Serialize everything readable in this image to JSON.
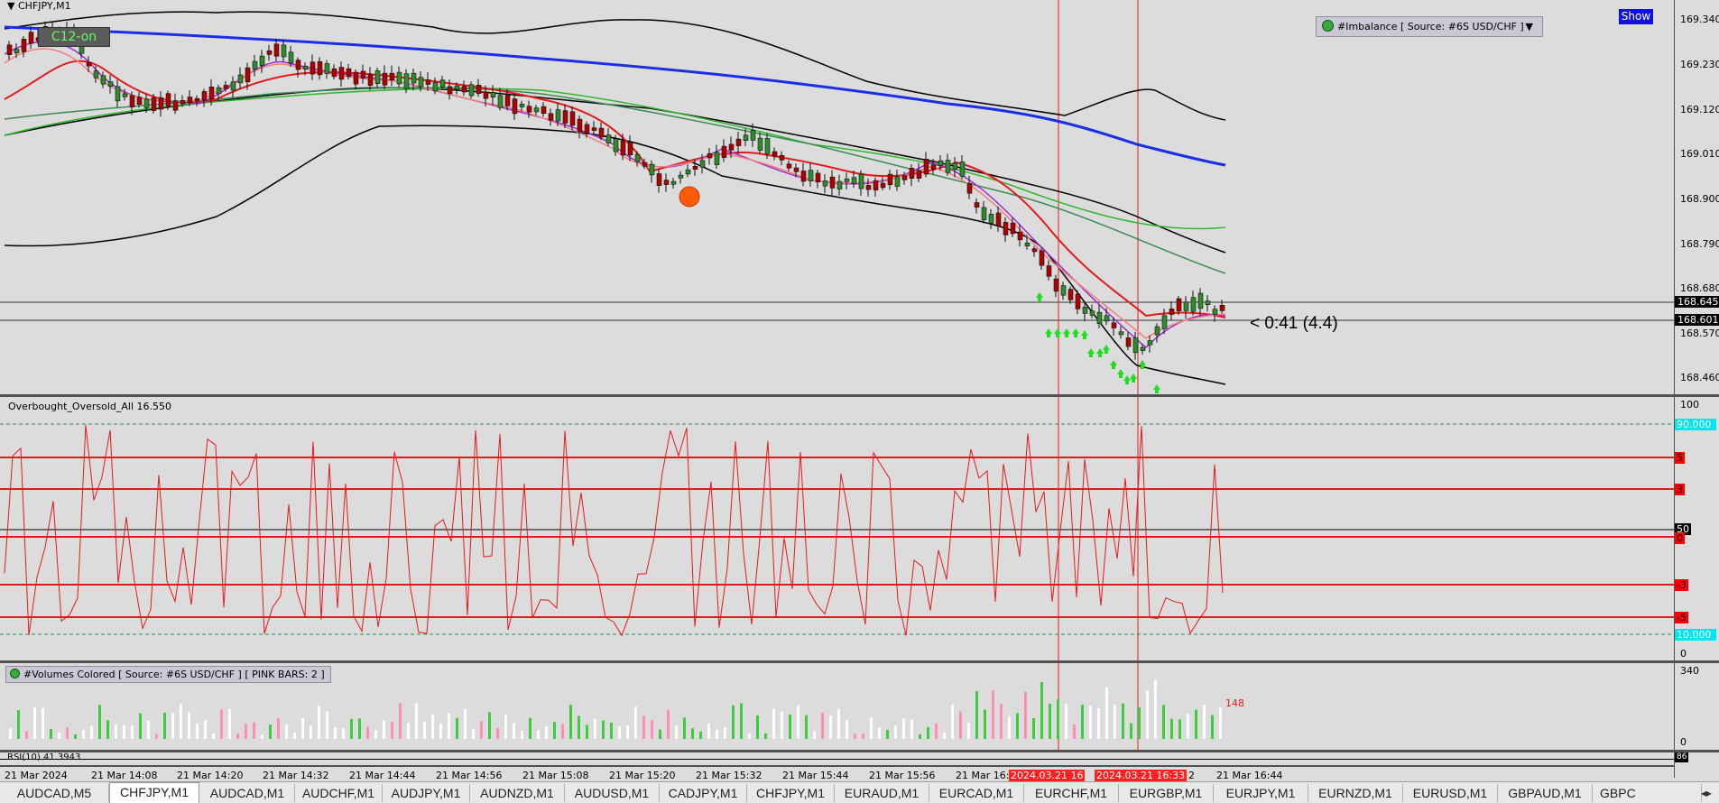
{
  "main": {
    "symbol_label": "CHFJPY,M1",
    "badge": "C12-on",
    "show_button": "Show",
    "imbalance_label": "#Imbalance [ Source: #6S USD/CHF ]",
    "spread_text": "< 0:41 (4.4)",
    "price_axis": [
      "169.340",
      "169.230",
      "169.120",
      "169.010",
      "168.900",
      "168.790",
      "168.680",
      "168.570",
      "168.460"
    ],
    "price_tags": [
      "168.645",
      "168.601"
    ]
  },
  "oscillator": {
    "label": "Overbought_Oversold_All 16.550",
    "axis_top": "100",
    "axis_bottom": "0",
    "level_tags": [
      "90.000",
      "5",
      "3",
      "0",
      "-3",
      "-5",
      "10.000"
    ],
    "mid_tag": "50"
  },
  "volumes": {
    "label": "#Volumes Colored [ Source: #6S USD/CHF ]  [ PINK BARS: 2 ]",
    "axis_top": "340",
    "axis_bottom": "0",
    "last_value": "148"
  },
  "rsi": {
    "label": "RSI(10) 41.3943",
    "tag": "86"
  },
  "time_axis": [
    "21 Mar 2024",
    "21 Mar 14:08",
    "21 Mar 14:20",
    "21 Mar 14:32",
    "21 Mar 14:44",
    "21 Mar 14:56",
    "21 Mar 15:08",
    "21 Mar 15:20",
    "21 Mar 15:32",
    "21 Mar 15:44",
    "21 Mar 15:56",
    "21 Mar 16:",
    "2",
    "21 Mar 16:44"
  ],
  "vline_labels": [
    "2024.03.21 16",
    "2024.03.21 16:33"
  ],
  "tabs": [
    "AUDCAD,M5",
    "CHFJPY,M1",
    "AUDCAD,M1",
    "AUDCHF,M1",
    "AUDJPY,M1",
    "AUDNZD,M1",
    "AUDUSD,M1",
    "CADJPY,M1",
    "CHFJPY,M1",
    "EURAUD,M1",
    "EURCAD,M1",
    "EURCHF,M1",
    "EURGBP,M1",
    "EURJPY,M1",
    "EURNZD,M1",
    "EURUSD,M1",
    "GBPAUD,M1",
    "GBPC"
  ],
  "active_tab_index": 1,
  "colors": {
    "background": "#dcdcdc",
    "bull_candle": "#2e8b2e",
    "bear_candle": "#b00000",
    "osc_line": "#e02020",
    "ma_blue": "#1a2ee6",
    "show_button_bg": "#1010e0",
    "cyan_tag": "#00e5ee",
    "red_tag": "#ff0000"
  }
}
